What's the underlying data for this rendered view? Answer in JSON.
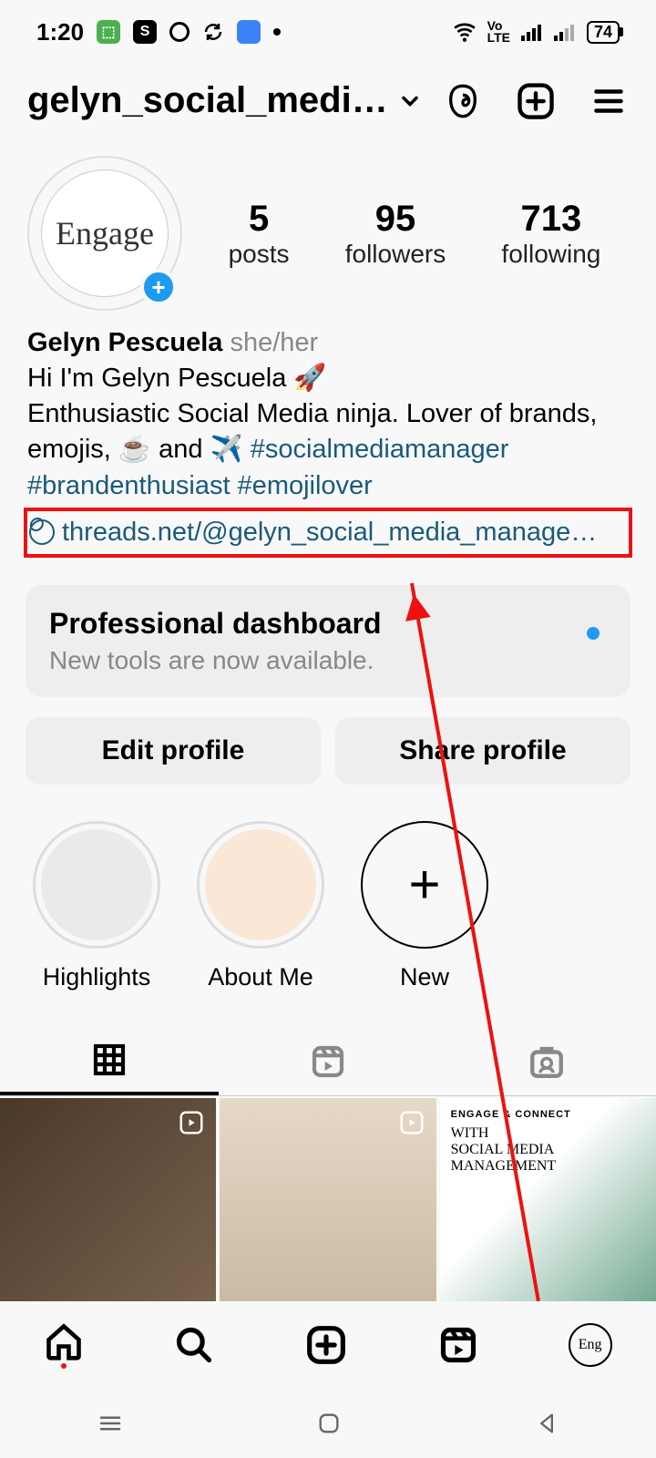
{
  "status_bar": {
    "time": "1:20",
    "battery": "74",
    "volte": "Vo\nLTE"
  },
  "header": {
    "username": "gelyn_social_medi…"
  },
  "stats": {
    "posts": {
      "count": "5",
      "label": "posts"
    },
    "followers": {
      "count": "95",
      "label": "followers"
    },
    "following": {
      "count": "713",
      "label": "following"
    }
  },
  "bio": {
    "avatar_text": "Engage",
    "display_name": "Gelyn Pescuela",
    "pronouns": "she/her",
    "line1": "Hi I'm Gelyn Pescuela 🚀",
    "line2_a": "Enthusiastic Social Media ninja. Lover of brands, emojis, ☕ and ✈️ ",
    "hashtags": "#socialmediamanager #brandenthusiast #emojilover",
    "link": "threads.net/@gelyn_social_media_manage…"
  },
  "dashboard": {
    "title": "Professional dashboard",
    "subtitle": "New tools are now available."
  },
  "buttons": {
    "edit": "Edit profile",
    "share": "Share profile"
  },
  "highlights": [
    {
      "label": "Highlights"
    },
    {
      "label": "About Me"
    },
    {
      "label": "New"
    }
  ],
  "tile3": {
    "brand": "ENGAGE & CONNECT",
    "line1": "WITH",
    "line2": "SOCIAL MEDIA",
    "line3": "MANAGEMENT"
  }
}
